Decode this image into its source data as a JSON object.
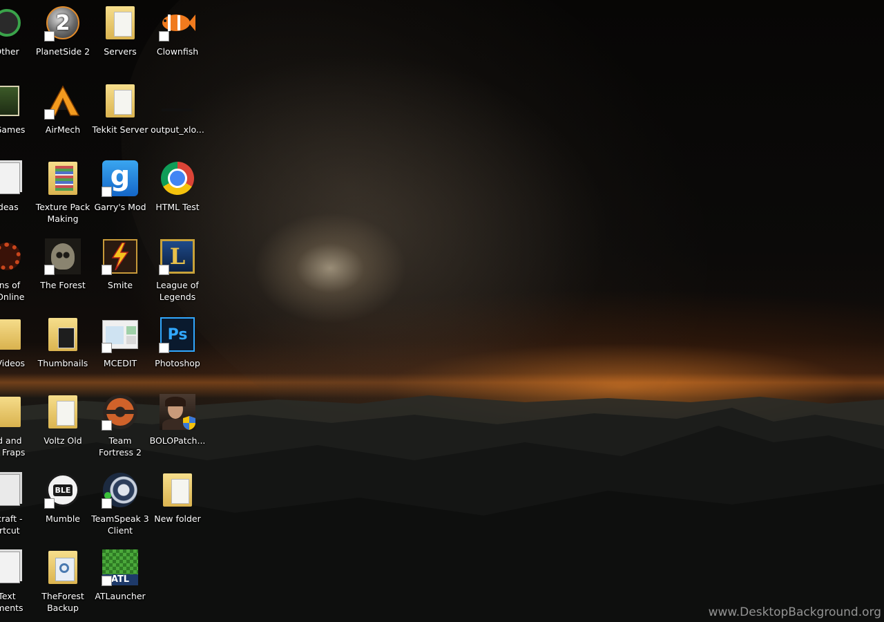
{
  "desktop": {
    "columns": [
      [
        {
          "label": "Other",
          "icon": "shortcut-app-icon"
        },
        {
          "label": "r Games",
          "icon": "shortcut-app-icon"
        },
        {
          "label": "Ideas",
          "icon": "document-icon"
        },
        {
          "label": "uns of\ns Online",
          "icon": "gear-icon"
        },
        {
          "label": "s Videos",
          "icon": "folder-icon"
        },
        {
          "label": "ed and\ndy Fraps",
          "icon": "folder-icon"
        },
        {
          "label": "ecraft -\nortcut",
          "icon": "document-icon"
        },
        {
          "label": "Text\numents",
          "icon": "document-icon"
        }
      ],
      [
        {
          "label": "PlanetSide 2",
          "icon": "planetside-icon"
        },
        {
          "label": "AirMech",
          "icon": "airmech-icon"
        },
        {
          "label": "Texture Pack\nMaking",
          "icon": "folder-icon"
        },
        {
          "label": "The Forest",
          "icon": "skull-icon"
        },
        {
          "label": "Thumbnails",
          "icon": "folder-icon"
        },
        {
          "label": "Voltz Old",
          "icon": "folder-icon"
        },
        {
          "label": "Mumble",
          "icon": "mumble-icon"
        },
        {
          "label": "TheForest\nBackup",
          "icon": "folder-icon"
        }
      ],
      [
        {
          "label": "Servers",
          "icon": "folder-icon"
        },
        {
          "label": "Tekkit Server",
          "icon": "folder-icon"
        },
        {
          "label": "Garry's Mod",
          "icon": "garrys-mod-icon"
        },
        {
          "label": "Smite",
          "icon": "smite-icon"
        },
        {
          "label": "MCEDIT",
          "icon": "mcedit-icon"
        },
        {
          "label": "Team\nFortress 2",
          "icon": "tf2-icon"
        },
        {
          "label": "TeamSpeak 3\nClient",
          "icon": "teamspeak-icon"
        },
        {
          "label": "ATLauncher",
          "icon": "atlauncher-icon"
        }
      ],
      [
        {
          "label": "Clownfish",
          "icon": "clownfish-icon"
        },
        {
          "label": "output_xlo...",
          "icon": "file-icon"
        },
        {
          "label": "HTML Test",
          "icon": "chrome-icon"
        },
        {
          "label": "League of\nLegends",
          "icon": "league-icon"
        },
        {
          "label": "Photoshop",
          "icon": "photoshop-icon"
        },
        {
          "label": "BOLOPatch...",
          "icon": "avatar-icon"
        },
        {
          "label": "New folder",
          "icon": "folder-icon"
        }
      ]
    ]
  },
  "icon_text": {
    "planetside": "2",
    "airmech": "A",
    "garrys_mod": "g",
    "league": "L",
    "photoshop": "Ps",
    "mumble": "BLE",
    "atlauncher": "ATL"
  },
  "watermark": "www.DesktopBackground.org",
  "colors": {
    "folder": "#e9c766",
    "selection": "#2d6fbf"
  }
}
